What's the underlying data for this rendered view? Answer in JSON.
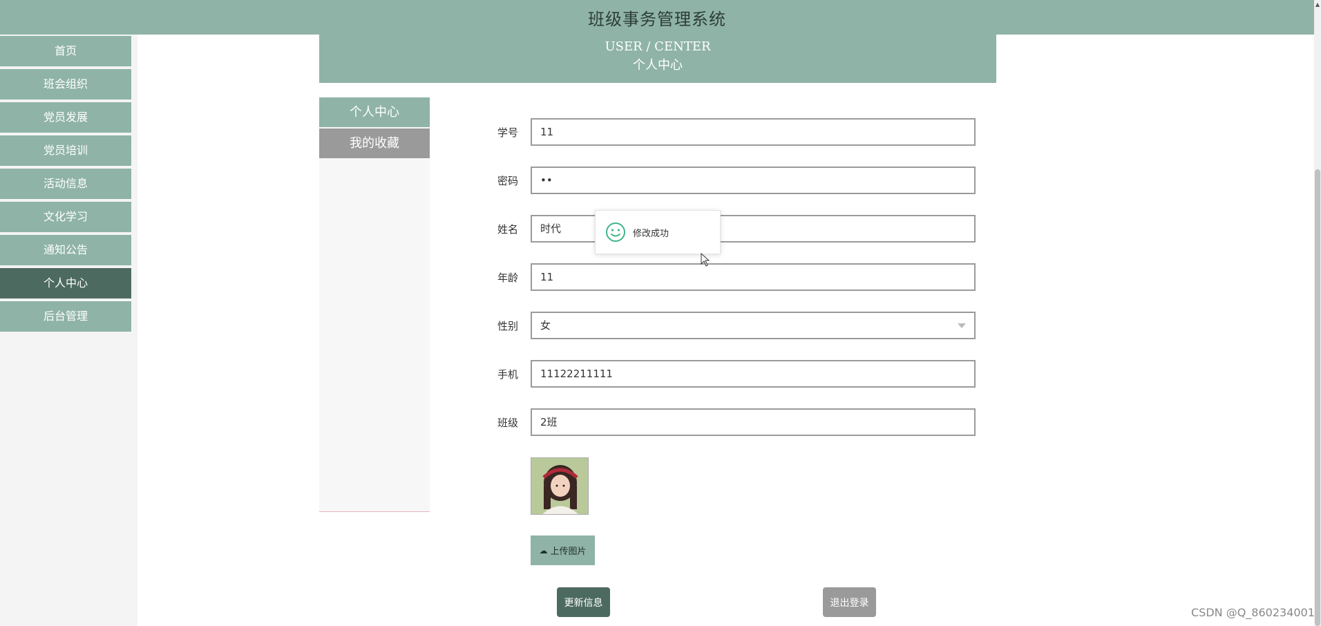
{
  "app_title": "班级事务管理系统",
  "nav": {
    "items": [
      {
        "label": "首页",
        "active": false
      },
      {
        "label": "班会组织",
        "active": false
      },
      {
        "label": "党员发展",
        "active": false
      },
      {
        "label": "党员培训",
        "active": false
      },
      {
        "label": "活动信息",
        "active": false
      },
      {
        "label": "文化学习",
        "active": false
      },
      {
        "label": "通知公告",
        "active": false
      },
      {
        "label": "个人中心",
        "active": true
      },
      {
        "label": "后台管理",
        "active": false
      }
    ]
  },
  "banner": {
    "en": "USER / CENTER",
    "zh": "个人中心"
  },
  "side_tabs": {
    "center": "个人中心",
    "favorites": "我的收藏"
  },
  "form": {
    "student_id": {
      "label": "学号",
      "value": "11"
    },
    "password": {
      "label": "密码",
      "value": "••"
    },
    "name": {
      "label": "姓名",
      "value": "时代"
    },
    "age": {
      "label": "年龄",
      "value": "11"
    },
    "gender": {
      "label": "性别",
      "value": "女"
    },
    "phone": {
      "label": "手机",
      "value": "11122211111"
    },
    "class": {
      "label": "班级",
      "value": "2班"
    }
  },
  "upload_label": "上传图片",
  "buttons": {
    "update": "更新信息",
    "logout": "退出登录"
  },
  "toast": {
    "message": "修改成功",
    "icon": "smile-icon"
  },
  "watermark": "CSDN @Q_860234001",
  "colors": {
    "accent": "#8fb3a7",
    "accent_dark": "#4d6a60",
    "muted": "#9a9a9a"
  }
}
